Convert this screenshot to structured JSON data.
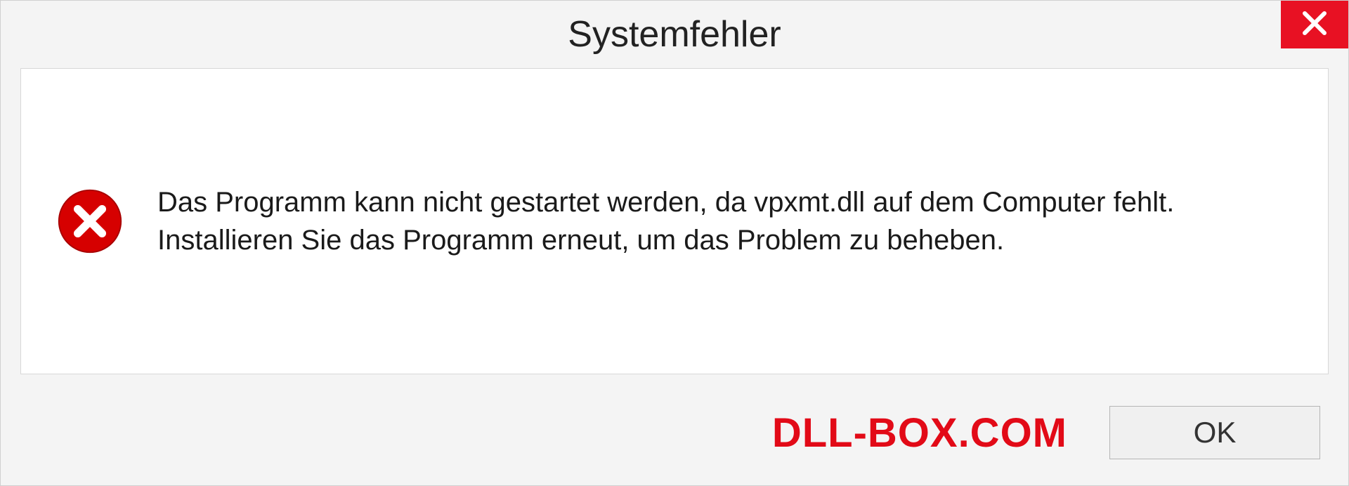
{
  "dialog": {
    "title": "Systemfehler",
    "message": "Das Programm kann nicht gestartet werden, da vpxmt.dll auf dem Computer fehlt. Installieren Sie das Programm erneut, um das Problem zu beheben.",
    "ok_label": "OK"
  },
  "watermark": "DLL-BOX.COM",
  "colors": {
    "close_bg": "#e81123",
    "error_red": "#e20a17",
    "error_circle": "#d60000"
  }
}
